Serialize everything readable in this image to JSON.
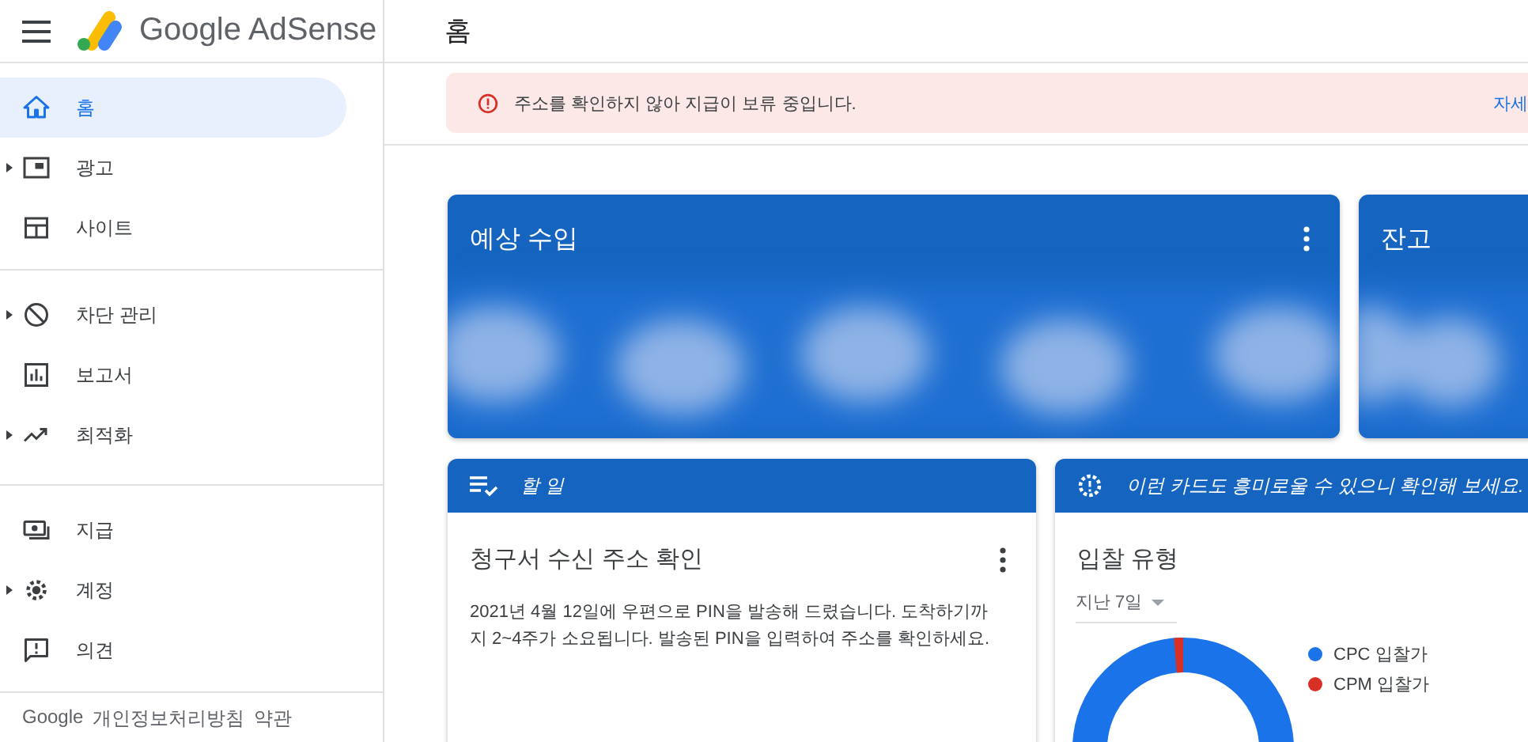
{
  "header": {
    "app_title": "Google AdSense",
    "page_title": "홈"
  },
  "sidebar": {
    "groups": [
      {
        "items": [
          {
            "label": "홈",
            "selected": true
          },
          {
            "label": "광고",
            "selected": false,
            "expanded": false
          },
          {
            "label": "사이트",
            "selected": false
          }
        ]
      },
      {
        "items": [
          {
            "label": "차단 관리",
            "selected": false,
            "expanded": false
          },
          {
            "label": "보고서",
            "selected": false
          },
          {
            "label": "최적화",
            "selected": false,
            "expanded": false
          }
        ]
      },
      {
        "items": [
          {
            "label": "지급",
            "selected": false
          },
          {
            "label": "계정",
            "selected": false,
            "expanded": false
          },
          {
            "label": "의견",
            "selected": false
          }
        ]
      }
    ],
    "footer": [
      "Google",
      "개인정보처리방침",
      "약관"
    ]
  },
  "alert": {
    "message": "주소를 확인하지 않아 지급이 보류 중입니다.",
    "link": "자세"
  },
  "earnings_card": {
    "title": "예상 수입"
  },
  "balance_card": {
    "title": "잔고"
  },
  "todo_card": {
    "header": "할 일",
    "title": "청구서 수신 주소 확인",
    "body": "2021년 4월 12일에 우편으로 PIN을 발송해 드렸습니다. 도착하기까지 2~4주가 소요됩니다. 발송된 PIN을 입력하여 주소를 확인하세요."
  },
  "info_card": {
    "header": "이런 카드도 흥미로울 수 있으니 확인해 보세요.",
    "title": "입찰 유형",
    "period": "지난 7일",
    "legend": [
      {
        "label": "CPC 입찰가",
        "color": "#1a73e8"
      },
      {
        "label": "CPM 입찰가",
        "color": "#d93025"
      }
    ]
  }
}
